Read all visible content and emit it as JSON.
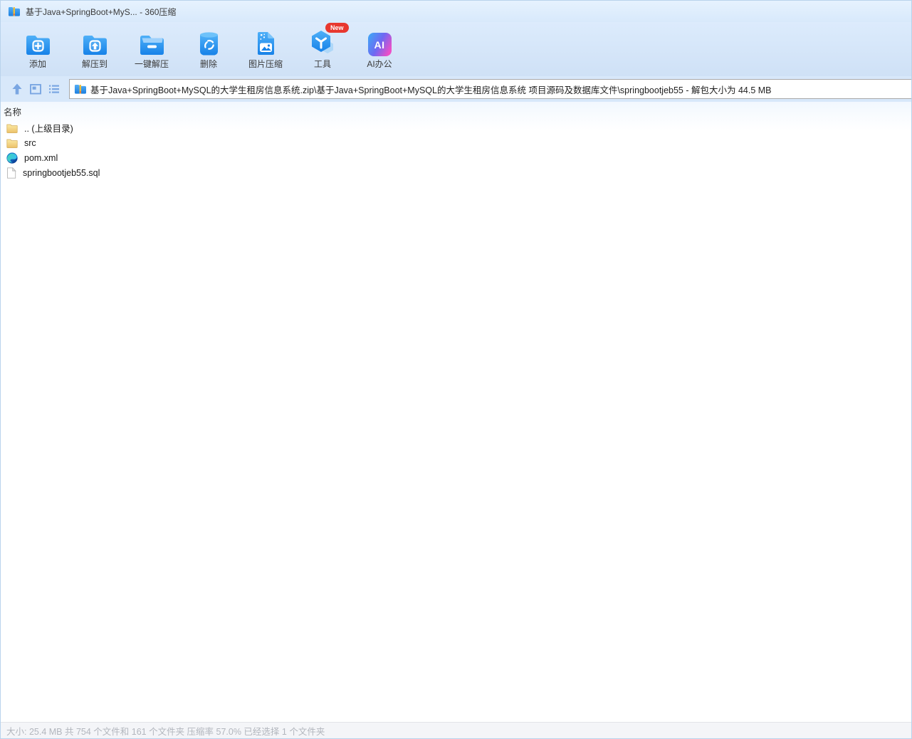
{
  "window": {
    "title": "基于Java+SpringBoot+MyS... - 360压缩",
    "app_name": "360压缩"
  },
  "colors": {
    "accent_blue": "#1782e8",
    "toolbar_bg": "#d6e7f9",
    "badge_red": "#e8382f",
    "folder_yellow": "#f0d182",
    "status_text": "#b2b6bd"
  },
  "toolbar": {
    "items": [
      {
        "label": "添加",
        "icon": "add-folder-icon"
      },
      {
        "label": "解压到",
        "icon": "extract-to-icon"
      },
      {
        "label": "一键解压",
        "icon": "one-click-extract-icon"
      },
      {
        "label": "删除",
        "icon": "delete-trash-icon"
      },
      {
        "label": "图片压缩",
        "icon": "image-compress-icon"
      },
      {
        "label": "工具",
        "icon": "tools-cube-icon",
        "badge": "New"
      },
      {
        "label": "AI办公",
        "icon": "ai-office-icon",
        "icon_text": "AI"
      }
    ]
  },
  "address_bar": {
    "path": "基于Java+SpringBoot+MySQL的大学生租房信息系统.zip\\基于Java+SpringBoot+MySQL的大学生租房信息系统 项目源码及数据库文件\\springbootjeb55 - 解包大小为 44.5 MB",
    "nav_icons": [
      "up-arrow-icon",
      "view-pane-icon",
      "list-view-icon"
    ]
  },
  "file_list": {
    "header": "名称",
    "items": [
      {
        "name": ".. (上级目录)",
        "icon": "folder-icon"
      },
      {
        "name": "src",
        "icon": "folder-icon"
      },
      {
        "name": "pom.xml",
        "icon": "edge-browser-icon"
      },
      {
        "name": "springbootjeb55.sql",
        "icon": "sql-file-icon"
      }
    ]
  },
  "status_bar": {
    "text": "大小: 25.4 MB 共 754 个文件和 161 个文件夹 压缩率 57.0% 已经选择 1 个文件夹"
  }
}
